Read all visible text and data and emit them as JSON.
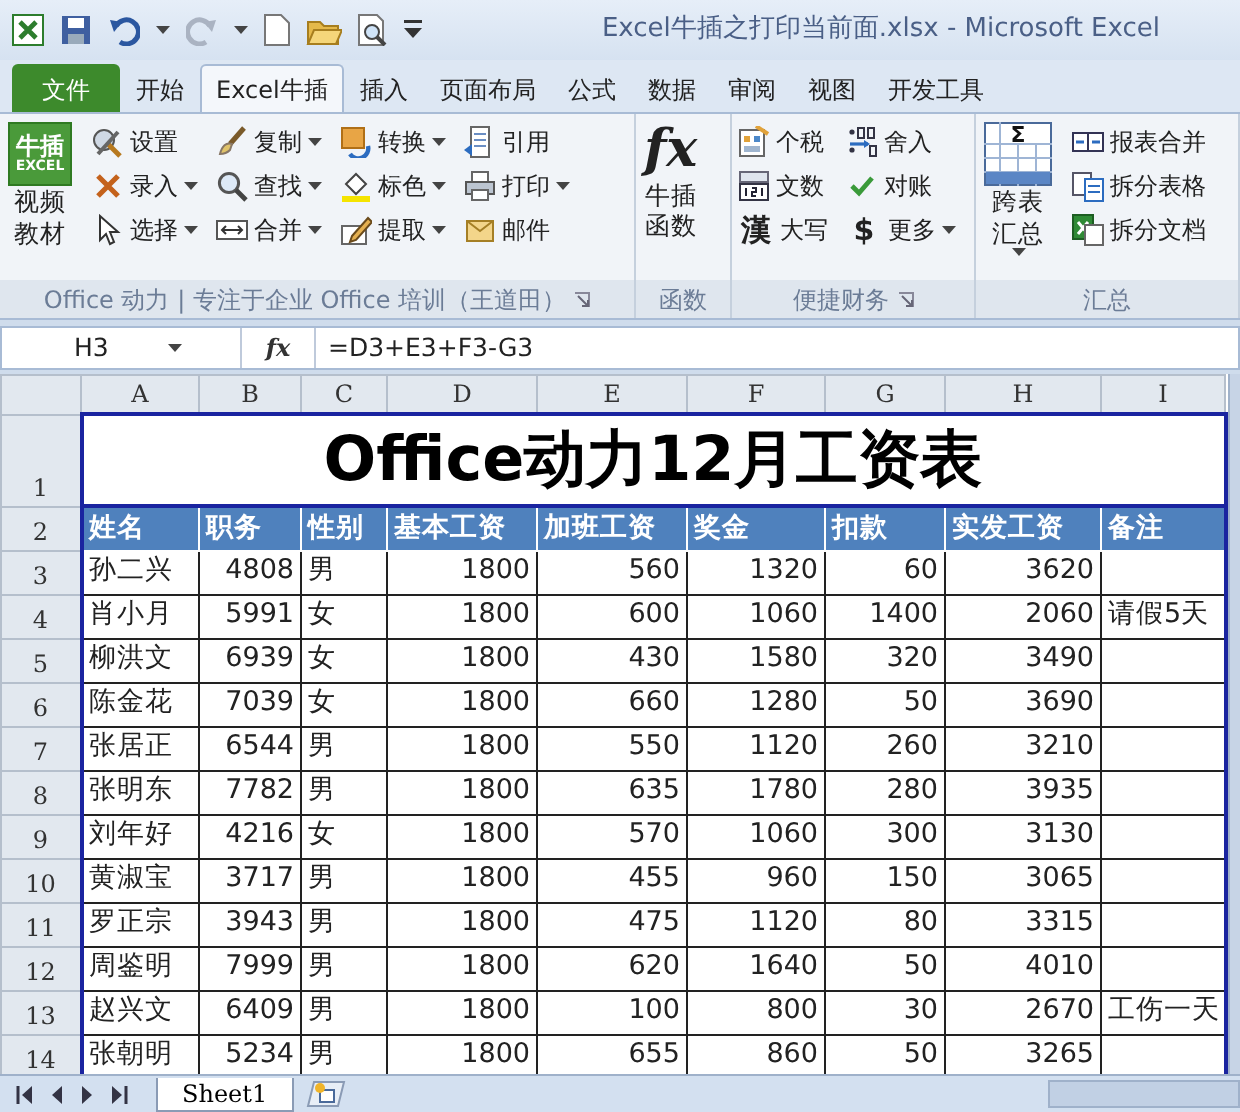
{
  "window": {
    "title": "Excel牛插之打印当前面.xlsx  -  Microsoft Excel"
  },
  "tabs": [
    {
      "label": "文件",
      "kind": "file",
      "selected": false
    },
    {
      "label": "开始",
      "kind": "tab",
      "selected": false
    },
    {
      "label": "Excel牛插",
      "kind": "tab",
      "selected": true
    },
    {
      "label": "插入",
      "kind": "tab",
      "selected": false
    },
    {
      "label": "页面布局",
      "kind": "tab",
      "selected": false
    },
    {
      "label": "公式",
      "kind": "tab",
      "selected": false
    },
    {
      "label": "数据",
      "kind": "tab",
      "selected": false
    },
    {
      "label": "审阅",
      "kind": "tab",
      "selected": false
    },
    {
      "label": "视图",
      "kind": "tab",
      "selected": false
    },
    {
      "label": "开发工具",
      "kind": "tab",
      "selected": false
    }
  ],
  "ribbon": {
    "groups": [
      {
        "label": "Office 动力 | 专注于企业 Office 培训（王道田）",
        "launcher": true,
        "big": {
          "kind": "logo",
          "logo_top": "牛插",
          "logo_bottom": "EXCEL",
          "label": "视频教材"
        },
        "columns": [
          [
            {
              "label": "设置",
              "dropdown": false
            },
            {
              "label": "录入",
              "dropdown": true
            },
            {
              "label": "选择",
              "dropdown": true
            }
          ],
          [
            {
              "label": "复制",
              "dropdown": true
            },
            {
              "label": "查找",
              "dropdown": true
            },
            {
              "label": "合并",
              "dropdown": true
            }
          ],
          [
            {
              "label": "转换",
              "dropdown": true
            },
            {
              "label": "标色",
              "dropdown": true
            },
            {
              "label": "提取",
              "dropdown": true
            }
          ],
          [
            {
              "label": "引用",
              "dropdown": false
            },
            {
              "label": "打印",
              "dropdown": true
            },
            {
              "label": "邮件",
              "dropdown": false
            }
          ]
        ]
      },
      {
        "label": "函数",
        "big": {
          "kind": "glyph",
          "glyph": "fx",
          "label": "牛插函数"
        }
      },
      {
        "label": "便捷财务",
        "launcher": true,
        "columns": [
          [
            {
              "label": "个税",
              "dropdown": false
            },
            {
              "label": "文数",
              "dropdown": false
            },
            {
              "label": "大写",
              "glyph": "漢",
              "dropdown": false
            }
          ],
          [
            {
              "label": "舍入",
              "dropdown": false
            },
            {
              "label": "对账",
              "dropdown": false
            },
            {
              "label": "更多",
              "glyph": "$",
              "dropdown": true
            }
          ]
        ]
      },
      {
        "label": "汇总",
        "big": {
          "kind": "sigma",
          "glyph": "Σ",
          "label": "跨表汇总",
          "dropdown": true
        },
        "columns": [
          [
            {
              "label": "报表合并",
              "dropdown": false
            },
            {
              "label": "拆分表格",
              "dropdown": false
            },
            {
              "label": "拆分文档",
              "dropdown": false
            }
          ]
        ]
      }
    ]
  },
  "formula_bar": {
    "name_box": "H3",
    "fx": "fx",
    "formula": "=D3+E3+F3-G3"
  },
  "sheet": {
    "columns": [
      "A",
      "B",
      "C",
      "D",
      "E",
      "F",
      "G",
      "H",
      "I"
    ],
    "rows": [
      {
        "number": "1",
        "kind": "title",
        "title": "Office动力12月工资表"
      },
      {
        "number": "2",
        "kind": "header",
        "cells": [
          "姓名",
          "职务",
          "性别",
          "基本工资",
          "加班工资",
          "奖金",
          "扣款",
          "实发工资",
          "备注"
        ]
      },
      {
        "number": "3",
        "kind": "data",
        "cells": [
          "孙二兴",
          "4808",
          "男",
          "1800",
          "560",
          "1320",
          "60",
          "3620"
        ]
      },
      {
        "number": "4",
        "kind": "data",
        "cells": [
          "肖小月",
          "5991",
          "女",
          "1800",
          "600",
          "1060",
          "1400",
          "2060"
        ],
        "note": "请假5天"
      },
      {
        "number": "5",
        "kind": "data",
        "cells": [
          "柳洪文",
          "6939",
          "女",
          "1800",
          "430",
          "1580",
          "320",
          "3490"
        ]
      },
      {
        "number": "6",
        "kind": "data",
        "cells": [
          "陈金花",
          "7039",
          "女",
          "1800",
          "660",
          "1280",
          "50",
          "3690"
        ]
      },
      {
        "number": "7",
        "kind": "data",
        "cells": [
          "张居正",
          "6544",
          "男",
          "1800",
          "550",
          "1120",
          "260",
          "3210"
        ]
      },
      {
        "number": "8",
        "kind": "data",
        "cells": [
          "张明东",
          "7782",
          "男",
          "1800",
          "635",
          "1780",
          "280",
          "3935"
        ]
      },
      {
        "number": "9",
        "kind": "data",
        "cells": [
          "刘年好",
          "4216",
          "女",
          "1800",
          "570",
          "1060",
          "300",
          "3130"
        ]
      },
      {
        "number": "10",
        "kind": "data",
        "cells": [
          "黄淑宝",
          "3717",
          "男",
          "1800",
          "455",
          "960",
          "150",
          "3065"
        ]
      },
      {
        "number": "11",
        "kind": "data",
        "cells": [
          "罗正宗",
          "3943",
          "男",
          "1800",
          "475",
          "1120",
          "80",
          "3315"
        ]
      },
      {
        "number": "12",
        "kind": "data",
        "cells": [
          "周鉴明",
          "7999",
          "男",
          "1800",
          "620",
          "1640",
          "50",
          "4010"
        ]
      },
      {
        "number": "13",
        "kind": "data",
        "cells": [
          "赵兴文",
          "6409",
          "男",
          "1800",
          "100",
          "800",
          "30",
          "2670"
        ],
        "note": "工伤一天"
      },
      {
        "number": "14",
        "kind": "data",
        "cells": [
          "张朝明",
          "5234",
          "男",
          "1800",
          "655",
          "860",
          "50",
          "3265"
        ]
      }
    ]
  },
  "sheet_tabs": [
    {
      "label": "Sheet1",
      "selected": true
    }
  ]
}
